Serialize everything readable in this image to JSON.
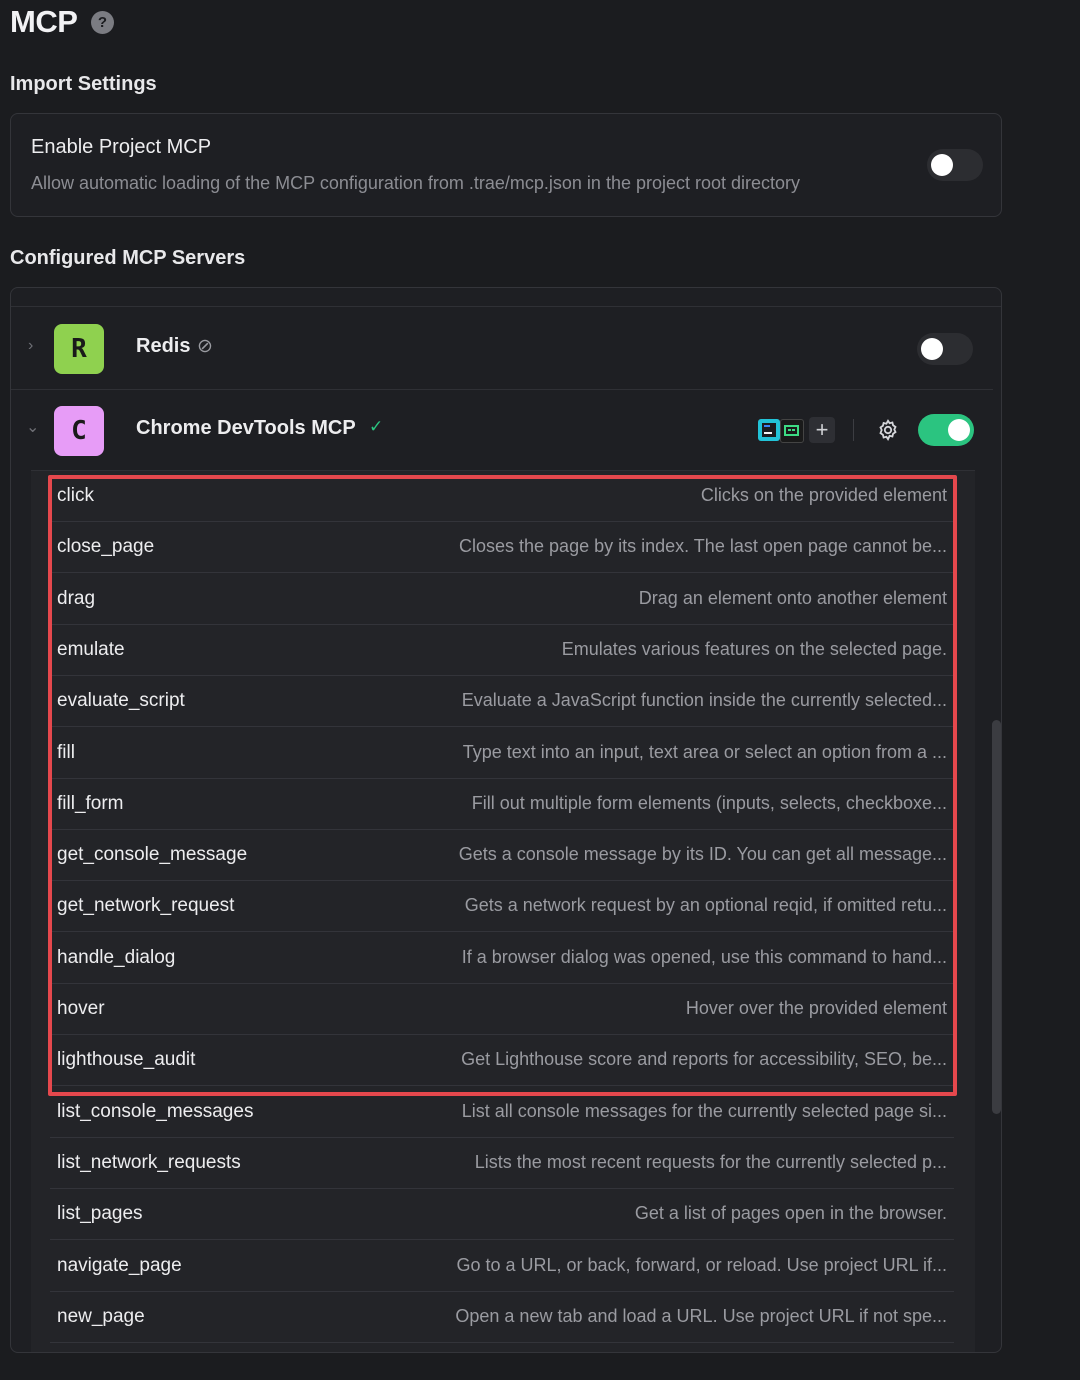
{
  "header": {
    "title": "MCP",
    "help_glyph": "?"
  },
  "import_settings": {
    "section_title": "Import Settings",
    "enable_project_mcp": {
      "title": "Enable Project MCP",
      "description": "Allow automatic loading of the MCP configuration from .trae/mcp.json in the project root directory",
      "enabled": false
    }
  },
  "configured_servers": {
    "section_title": "Configured MCP Servers",
    "servers": [
      {
        "name": "Redis",
        "avatar_letter": "R",
        "avatar_color": "#8fd14f",
        "status_glyph": "⊘",
        "status": "disabled",
        "expanded": false,
        "enabled": false,
        "chevron_glyph": "›"
      },
      {
        "name": "Chrome DevTools MCP",
        "avatar_letter": "C",
        "avatar_color": "#e79cf7",
        "status_glyph": "✓",
        "status": "connected",
        "expanded": true,
        "enabled": true,
        "chevron_glyph": "⌄",
        "add_glyph": "+",
        "tools": [
          {
            "name": "click",
            "description": "Clicks on the provided element"
          },
          {
            "name": "close_page",
            "description": "Closes the page by its index. The last open page cannot be..."
          },
          {
            "name": "drag",
            "description": "Drag an element onto another element"
          },
          {
            "name": "emulate",
            "description": "Emulates various features on the selected page."
          },
          {
            "name": "evaluate_script",
            "description": "Evaluate a JavaScript function inside the currently selected..."
          },
          {
            "name": "fill",
            "description": "Type text into an input, text area or select an option from a ..."
          },
          {
            "name": "fill_form",
            "description": "Fill out multiple form elements (inputs, selects, checkboxe..."
          },
          {
            "name": "get_console_message",
            "description": "Gets a console message by its ID. You can get all message..."
          },
          {
            "name": "get_network_request",
            "description": "Gets a network request by an optional reqid, if omitted retu..."
          },
          {
            "name": "handle_dialog",
            "description": "If a browser dialog was opened, use this command to hand..."
          },
          {
            "name": "hover",
            "description": "Hover over the provided element"
          },
          {
            "name": "lighthouse_audit",
            "description": "Get Lighthouse score and reports for accessibility, SEO, be..."
          },
          {
            "name": "list_console_messages",
            "description": "List all console messages for the currently selected page si..."
          },
          {
            "name": "list_network_requests",
            "description": "Lists the most recent requests for the currently selected p..."
          },
          {
            "name": "list_pages",
            "description": "Get a list of pages open in the browser."
          },
          {
            "name": "navigate_page",
            "description": "Go to a URL, or back, forward, or reload. Use project URL if..."
          },
          {
            "name": "new_page",
            "description": "Open a new tab and load a URL. Use project URL if not spe..."
          }
        ]
      }
    ]
  },
  "colors": {
    "toggle_on": "#2bc480",
    "toggle_off": "#2c2d31",
    "highlight_border": "#e5484d",
    "status_check": "#2bc480"
  },
  "icons": {
    "gear": "gear-icon",
    "add": "plus-icon",
    "ide_1": "ide-icon-1",
    "ide_2": "ide-icon-2"
  }
}
